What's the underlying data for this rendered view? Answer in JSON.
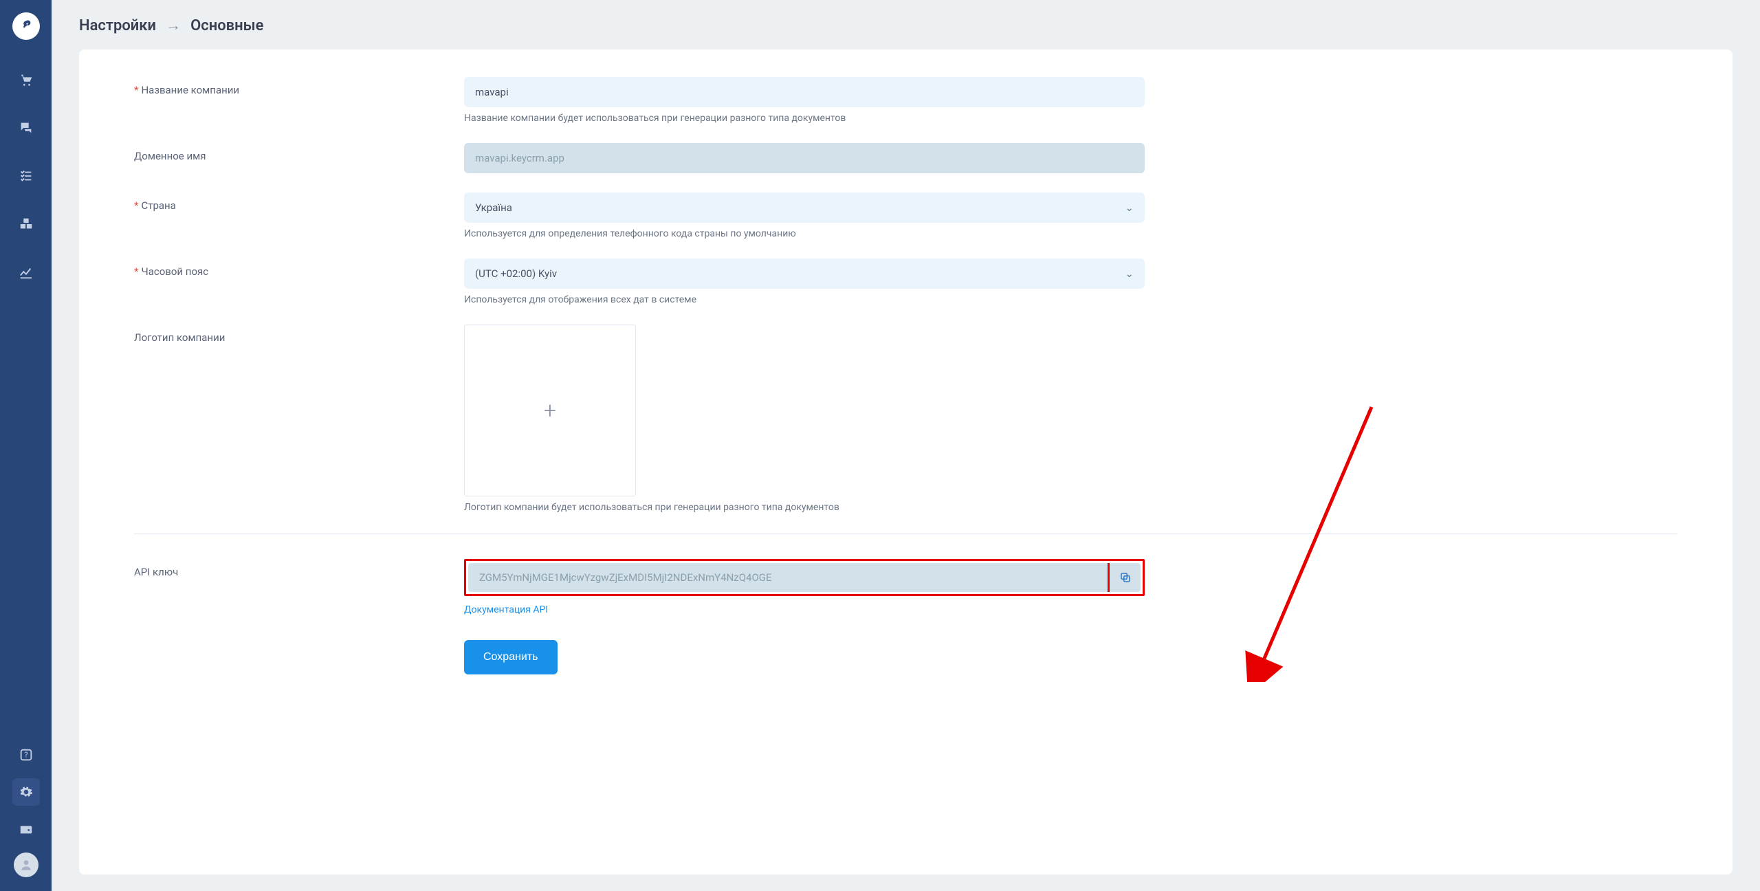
{
  "breadcrumb": {
    "root": "Настройки",
    "current": "Основные"
  },
  "fields": {
    "company": {
      "label": "Название компании",
      "value": "mavapi",
      "hint": "Название компании будет использоваться при генерации разного типа документов"
    },
    "domain": {
      "label": "Доменное имя",
      "value": "mavapi.keycrm.app"
    },
    "country": {
      "label": "Страна",
      "value": "Україна",
      "hint": "Используется для определения телефонного кода страны по умолчанию"
    },
    "timezone": {
      "label": "Часовой пояс",
      "value": "(UTC +02:00) Kyiv",
      "hint": "Используется для отображения всех дат в системе"
    },
    "logo": {
      "label": "Логотип компании",
      "hint": "Логотип компании будет использоваться при генерации разного типа документов"
    },
    "api": {
      "label": "API ключ",
      "value": "ZGM5YmNjMGE1MjcwYzgwZjExMDI5MjI2NDExNmY4NzQ4OGE",
      "doc_link": "Документация API"
    }
  },
  "buttons": {
    "save": "Сохранить"
  }
}
